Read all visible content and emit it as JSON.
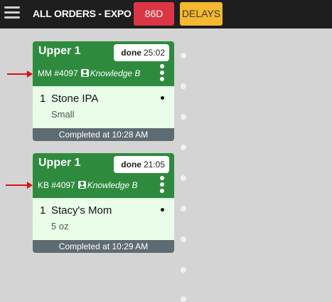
{
  "header": {
    "title": "ALL ORDERS - EXPO",
    "btn_86d": "86D",
    "btn_delays": "DELAYS"
  },
  "orders": [
    {
      "table": "Upper 1",
      "status": "done",
      "timer": "25:02",
      "initials": "MM",
      "check": "#4097",
      "server": "Knowledge B",
      "items": [
        {
          "qty": "1",
          "name": "Stone IPA",
          "modifier": "Small"
        }
      ],
      "footer": "Completed at 10:28 AM"
    },
    {
      "table": "Upper 1",
      "status": "done",
      "timer": "21:05",
      "initials": "KB",
      "check": "#4097",
      "server": "Knowledge B",
      "items": [
        {
          "qty": "1",
          "name": "Stacy's Mom",
          "modifier": "5 oz"
        }
      ],
      "footer": "Completed at 10:29 AM"
    }
  ],
  "colors": {
    "header_bg": "#1e1e1e",
    "card_green": "#2e8b3e",
    "card_body": "#e9fde9",
    "footer_gray": "#5f6b73",
    "btn_86d": "#dc3545",
    "btn_delays": "#f5b82e",
    "arrow_red": "#e01010"
  }
}
